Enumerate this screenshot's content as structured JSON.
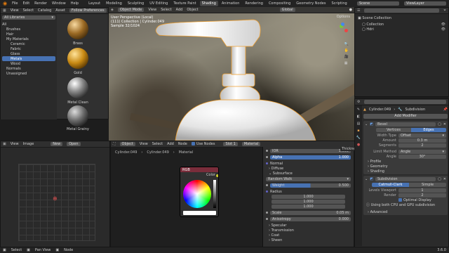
{
  "topbar": {
    "menu": [
      "File",
      "Edit",
      "Render",
      "Window",
      "Help"
    ],
    "tabs": [
      "Layout",
      "Modeling",
      "Sculpting",
      "UV Editing",
      "Texture Paint",
      "Shading",
      "Animation",
      "Rendering",
      "Compositing",
      "Geometry Nodes",
      "Scripting"
    ],
    "active_tab": "Shading",
    "scene": "Scene",
    "view_layer": "ViewLayer"
  },
  "file_browser": {
    "menu": [
      "View",
      "Select",
      "Catalog",
      "Asset"
    ],
    "search": "Follow Preferences",
    "all_libraries": "All Libraries",
    "tree": [
      "All",
      "Brushes",
      "Hair",
      "My Materials",
      "Ceramic",
      "Fabric",
      "Glass",
      "Metals",
      "Wood",
      "Normals",
      "Unassigned"
    ],
    "selected": "Metals",
    "assets": [
      "Brass",
      "Gold",
      "Metal Clean",
      "Metal Grainy"
    ]
  },
  "viewport": {
    "mode": "Object Mode",
    "menu": [
      "View",
      "Select",
      "Add",
      "Object"
    ],
    "transform": "Global",
    "info_line1": "User Perspective (Local)",
    "info_line2": "(111) Collection | Cylinder.049",
    "info_line3": "Sample 32/1024",
    "options": "Options"
  },
  "image_editor": {
    "menu": [
      "View",
      "Image"
    ],
    "new_btn": "New",
    "open_btn": "Open"
  },
  "node_editor": {
    "object_label": "Object",
    "menu": [
      "View",
      "Select",
      "Add",
      "Node"
    ],
    "use_nodes": "Use Nodes",
    "slot": "Slot 1",
    "material": "Material",
    "breadcrumb": [
      "Cylinder.049",
      "Cylinder.049",
      "Material"
    ],
    "rgb_node": {
      "title": "RGB",
      "output": "Color"
    },
    "thickness": "Thickness"
  },
  "node_props": {
    "ior_label": "IOR",
    "ior_value": "1.500",
    "alpha_label": "Alpha",
    "alpha_value": "1.000",
    "normal": "Normal",
    "diffuse": "Diffuse",
    "subsurface": "Subsurface",
    "method": "Random Walk",
    "weight_label": "Weight",
    "weight_value": "0.500",
    "radius": "Radius",
    "radius_values": [
      "1.000",
      "1.000",
      "1.000"
    ],
    "scale_label": "Scale",
    "scale_value": "0.05 m",
    "anisotropy_label": "Anisotropy",
    "anisotropy_value": "0.000",
    "sections": [
      "Specular",
      "Transmission",
      "Coat",
      "Sheen"
    ]
  },
  "outliner": {
    "scene_collection": "Scene Collection",
    "items": [
      "Collection",
      "Hdri"
    ]
  },
  "properties": {
    "object": "Cylinder.049",
    "modifier_tab": "Subdivision",
    "add_modifier": "Add Modifier",
    "bevel": {
      "name": "Bevel",
      "modes": [
        "Vertices",
        "Edges"
      ],
      "active_mode": "Edges",
      "width_type_label": "Width Type",
      "width_type": "Offset",
      "amount_label": "Amount",
      "amount": "0.3 m",
      "segments_label": "Segments",
      "segments": "2",
      "limit_label": "Limit Method",
      "limit": "Angle",
      "angle_label": "Angle",
      "angle": "30°",
      "subs": [
        "Profile",
        "Geometry",
        "Shading"
      ]
    },
    "subdivision": {
      "name": "Subdivision",
      "modes": [
        "Catmull-Clark",
        "Simple"
      ],
      "active_mode": "Catmull-Clark",
      "levels_viewport_label": "Levels Viewport",
      "levels_viewport": "1",
      "render_label": "Render",
      "render": "2",
      "optimal_display": "Optimal Display",
      "gpu_note": "Using both CPU and GPU subdivision",
      "advanced": "Advanced"
    }
  },
  "statusbar": {
    "items": [
      "Select",
      "Pan View",
      "Node"
    ],
    "version": "3.6.0"
  }
}
